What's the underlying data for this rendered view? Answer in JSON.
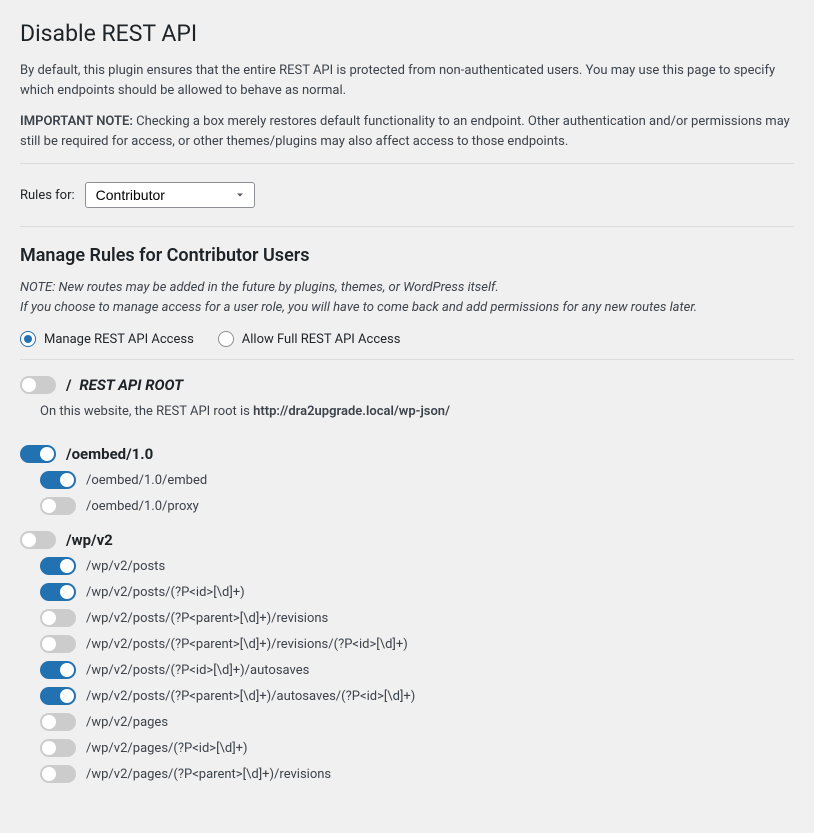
{
  "page_title": "Disable REST API",
  "intro_text": "By default, this plugin ensures that the entire REST API is protected from non-authenticated users. You may use this page to specify which endpoints should be allowed to behave as normal.",
  "important_note_label": "IMPORTANT NOTE:",
  "important_note_text": " Checking a box merely restores default functionality to an endpoint. Other authentication and/or permissions may still be required for access, or other themes/plugins may also affect access to those endpoints.",
  "rules_for_label": "Rules for:",
  "role_selected": "Contributor",
  "section_title": "Manage Rules for Contributor Users",
  "note_line1": "NOTE: New routes may be added in the future by plugins, themes, or WordPress itself.",
  "note_line2": "If you choose to manage access for a user role, you will have to come back and add permissions for any new routes later.",
  "radio_manage": "Manage REST API Access",
  "radio_allow": "Allow Full REST API Access",
  "root_slash": "/",
  "root_desc": "REST API ROOT",
  "root_note_prefix": "On this website, the REST API root is ",
  "root_note_url": "http://dra2upgrade.local/wp-json/",
  "groups": {
    "oembed": {
      "label": "/oembed/1.0",
      "children": {
        "embed": "/oembed/1.0/embed",
        "proxy": "/oembed/1.0/proxy"
      }
    },
    "wpv2": {
      "label": "/wp/v2",
      "children": {
        "posts": "/wp/v2/posts",
        "posts_id": "/wp/v2/posts/(?P<id>[\\d]+)",
        "posts_revisions": "/wp/v2/posts/(?P<parent>[\\d]+)/revisions",
        "posts_revisions_id": "/wp/v2/posts/(?P<parent>[\\d]+)/revisions/(?P<id>[\\d]+)",
        "posts_autosaves": "/wp/v2/posts/(?P<id>[\\d]+)/autosaves",
        "posts_autosaves_id": "/wp/v2/posts/(?P<parent>[\\d]+)/autosaves/(?P<id>[\\d]+)",
        "pages": "/wp/v2/pages",
        "pages_id": "/wp/v2/pages/(?P<id>[\\d]+)",
        "pages_revisions": "/wp/v2/pages/(?P<parent>[\\d]+)/revisions"
      }
    }
  }
}
